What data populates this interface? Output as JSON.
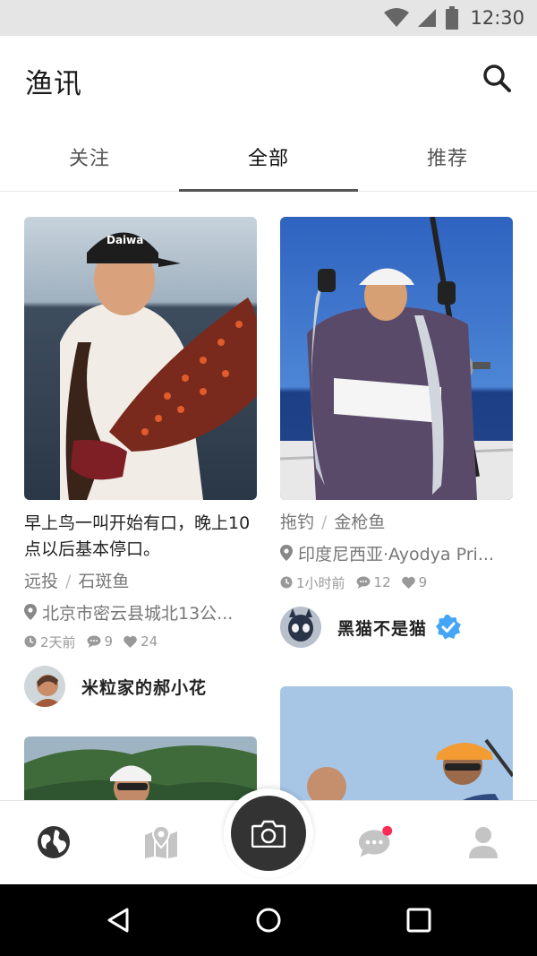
{
  "status_bar": {
    "time": "12:30"
  },
  "app": {
    "title": "渔讯"
  },
  "tabs": [
    {
      "label": "关注"
    },
    {
      "label": "全部"
    },
    {
      "label": "推荐"
    }
  ],
  "feed": {
    "posts": [
      {
        "title": "早上鸟一叫开始有口，晚上10点以后基本停口。",
        "tags": [
          "远投",
          "石斑鱼"
        ],
        "location": "北京市密云县城北13公...",
        "time": "2天前",
        "comments": "9",
        "likes": "24",
        "author": "米粒家的郝小花",
        "verified": false
      },
      {
        "title": "",
        "tags": [
          "拖钓",
          "金枪鱼"
        ],
        "location": "印度尼西亚·Ayodya Pri...",
        "time": "1小时前",
        "comments": "12",
        "likes": "9",
        "author": "黑猫不是猫",
        "verified": true
      }
    ]
  },
  "bottom_nav": {
    "items": [
      {
        "icon": "globe-icon",
        "active": true
      },
      {
        "icon": "map-icon",
        "active": false
      },
      {
        "icon": "camera-icon",
        "active": false
      },
      {
        "icon": "chat-icon",
        "active": false,
        "badge": true
      },
      {
        "icon": "profile-icon",
        "active": false
      }
    ]
  },
  "colors": {
    "accent": "#333333",
    "badge": "#ff2d55",
    "verified": "#42a5f5",
    "muted": "#777777"
  }
}
